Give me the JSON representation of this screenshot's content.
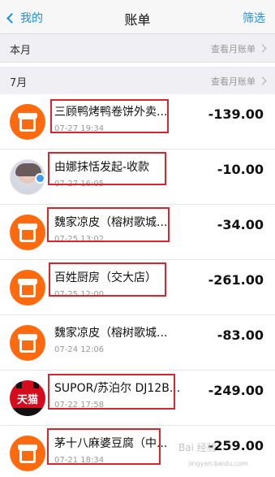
{
  "navbar": {
    "back_label": "我的",
    "title": "账单",
    "filter_label": "筛选"
  },
  "sections": [
    {
      "label": "本月",
      "link": "查看月账单"
    },
    {
      "label": "7月",
      "link": "查看月账单"
    }
  ],
  "transactions": [
    {
      "title": "三顾鸭烤鸭卷饼外卖...",
      "time": "07-27 19:34",
      "amount": "-139.00",
      "icon": "shop-icon"
    },
    {
      "title": "由娜抹恬发起-收款",
      "time": "07-27 16:05",
      "amount": "-10.00",
      "icon": "user-photo-icon"
    },
    {
      "title": "魏家凉皮（榕树歌城...",
      "time": "07-25 13:02",
      "amount": "-34.00",
      "icon": "shop-icon"
    },
    {
      "title": "百姓厨房（交大店）",
      "time": "07-25 12:00",
      "amount": "-261.00",
      "icon": "shop-icon"
    },
    {
      "title": "魏家凉皮（榕树歌城...",
      "time": "07-24 12:06",
      "amount": "-83.00",
      "icon": "shop-icon"
    },
    {
      "title": "SUPOR/苏泊尔 DJ12B...",
      "time": "07-22 17:58",
      "amount": "-249.00",
      "icon": "tmall-icon"
    },
    {
      "title": "茅十八麻婆豆腐（中...",
      "time": "07-21 18:34",
      "amount": "-259.00",
      "icon": "shop-icon"
    }
  ],
  "tmall_icon_text": "天猫",
  "watermark": {
    "main": "Bai 经验",
    "sub": "jingyan.baidu.com"
  },
  "colors": {
    "accent": "#1a8ef0",
    "shop_orange": "#ff6a0e",
    "highlight": "#d9262e",
    "tmall_red": "#d40c1c"
  }
}
